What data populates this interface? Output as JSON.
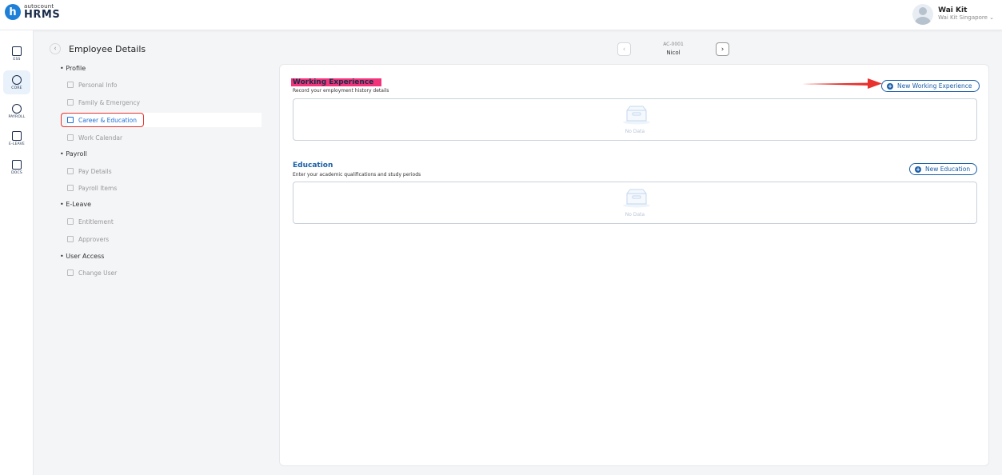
{
  "header": {
    "logo_small": "autocount",
    "logo_big": "HRMS",
    "logo_letter": "h",
    "user_name": "Wai Kit",
    "user_org": "Wai Kit Singapore"
  },
  "leftnav": [
    {
      "label": "ESS",
      "icon": "ess-icon"
    },
    {
      "label": "CORE",
      "icon": "core-icon"
    },
    {
      "label": "PAYROLL",
      "icon": "payroll-icon"
    },
    {
      "label": "E-LEAVE",
      "icon": "calendar-icon"
    },
    {
      "label": "DOCS",
      "icon": "docs-icon"
    }
  ],
  "submenu": {
    "title": "Employee Details",
    "sections": {
      "profile": "Profile",
      "payroll": "Payroll",
      "eleave": "E-Leave",
      "useraccess": "User Access"
    },
    "items": {
      "personal_info": "Personal Info",
      "family": "Family & Emergency",
      "career": "Career & Education",
      "work_calendar": "Work Calendar",
      "pay_details": "Pay Details",
      "payroll_items": "Payroll Items",
      "entitlement": "Entitlement",
      "approvers": "Approvers",
      "change_user": "Change User"
    },
    "active_item": "Career & Education"
  },
  "record": {
    "code": "AC-0001",
    "name": "Nicol"
  },
  "working_experience": {
    "title": "Working Experience",
    "subtitle": "Record your employment history details",
    "button": "New Working Experience",
    "empty": "No Data"
  },
  "education": {
    "title": "Education",
    "subtitle": "Enter your academic qualifications and study periods",
    "button": "New Education",
    "empty": "No Data"
  },
  "colors": {
    "accent": "#1a5fa8",
    "highlight": "#f2347a",
    "annotation_red": "#e8322e"
  }
}
